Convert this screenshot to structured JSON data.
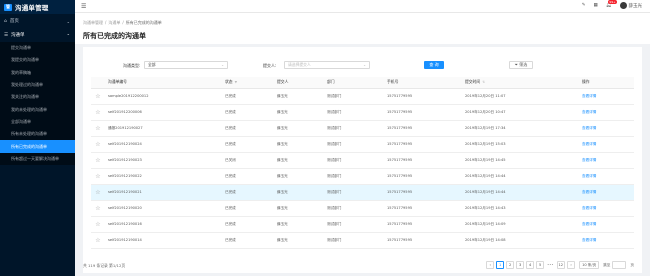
{
  "app": {
    "title": "沟通单管理",
    "logo_glyph": "管"
  },
  "sidebar": {
    "home_label": "首页",
    "group_label": "沟通单",
    "items": [
      {
        "label": "提交沟通单"
      },
      {
        "label": "我提交的沟通单"
      },
      {
        "label": "我的草稿箱"
      },
      {
        "label": "我处理过的沟通单"
      },
      {
        "label": "我关注的沟通单"
      },
      {
        "label": "我的未处理的沟通单"
      },
      {
        "label": "全部沟通单"
      },
      {
        "label": "所有未处理的沟通单"
      },
      {
        "label": "所有已完成的沟通单",
        "active": true
      },
      {
        "label": "所有超过一天要解决沟通单"
      }
    ]
  },
  "topbar": {
    "badge_count": "99+",
    "user_name": "薛玉光"
  },
  "breadcrumb": [
    "沟通单管理",
    "沟通单",
    "所有已完成的沟通单"
  ],
  "page_title": "所有已完成的沟通单",
  "filters": {
    "type_label": "沟通类型:",
    "type_value": "全部",
    "submitter_label": "提交人:",
    "submitter_placeholder": "请选择提交人",
    "search_button": "查 询",
    "filter_button": "筛选"
  },
  "table": {
    "columns": [
      "沟通单编号",
      "状态",
      "提交人",
      "部门",
      "手机号",
      "提交时间",
      "操作"
    ],
    "rows": [
      {
        "id": "sample201912200012",
        "status": "已完成",
        "submitter": "薛玉光",
        "dept": "测试部门",
        "phone": "15751779595",
        "time": "2019年12月20日 11:07",
        "action": "查看详情"
      },
      {
        "id": "self201912200006",
        "status": "已完成",
        "submitter": "薛玉光",
        "dept": "测试部门",
        "phone": "15751779595",
        "time": "2019年12月20日 10:47",
        "action": "查看详情"
      },
      {
        "id": "通报201912190027",
        "status": "已完成",
        "submitter": "薛玉光",
        "dept": "测试部门",
        "phone": "15751779595",
        "time": "2019年12月19日 17:34",
        "action": "查看详情"
      },
      {
        "id": "self201912190024",
        "status": "已完成",
        "submitter": "薛玉光",
        "dept": "测试部门",
        "phone": "15751779595",
        "time": "2019年12月19日 15:03",
        "action": "查看详情"
      },
      {
        "id": "self201912190023",
        "status": "已关闭",
        "submitter": "薛玉光",
        "dept": "测试部门",
        "phone": "15751779595",
        "time": "2019年12月19日 14:45",
        "action": "查看详情"
      },
      {
        "id": "self201912190022",
        "status": "已完成",
        "submitter": "薛玉光",
        "dept": "测试部门",
        "phone": "15751779595",
        "time": "2019年12月19日 14:44",
        "action": "查看详情"
      },
      {
        "id": "self201912190021",
        "status": "已完成",
        "submitter": "薛玉光",
        "dept": "测试部门",
        "phone": "15751779595",
        "time": "2019年12月19日 14:44",
        "action": "查看详情",
        "highlight": true
      },
      {
        "id": "self201912190020",
        "status": "已完成",
        "submitter": "薛玉光",
        "dept": "测试部门",
        "phone": "15751779595",
        "time": "2019年12月19日 14:43",
        "action": "查看详情"
      },
      {
        "id": "self201912190016",
        "status": "已完成",
        "submitter": "薛玉光",
        "dept": "测试部门",
        "phone": "15751779595",
        "time": "2019年12月19日 14:09",
        "action": "查看详情"
      },
      {
        "id": "self201912190014",
        "status": "已完成",
        "submitter": "薛玉光",
        "dept": "测试部门",
        "phone": "15751779595",
        "time": "2019年12月19日 14:08",
        "action": "查看详情"
      }
    ]
  },
  "pagination": {
    "total_text": "共 119 条记录 第1/12页",
    "pages": [
      "1",
      "2",
      "3",
      "4",
      "5"
    ],
    "last_page": "12",
    "ellipsis": "•••",
    "size_label": "10 条/页",
    "jump_prefix": "跳至",
    "jump_suffix": "页"
  }
}
